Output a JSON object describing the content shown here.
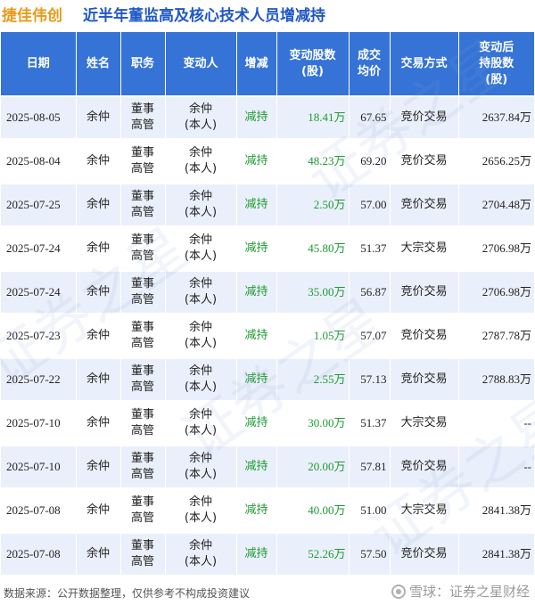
{
  "header": {
    "company": "捷佳伟创",
    "title": "近半年董监高及核心技术人员增减持"
  },
  "table": {
    "columns": [
      [
        "日期"
      ],
      [
        "姓名"
      ],
      [
        "职务"
      ],
      [
        "变动人"
      ],
      [
        "增减"
      ],
      [
        "变动股数",
        "(股)"
      ],
      [
        "成交",
        "均价"
      ],
      [
        "交易方式"
      ],
      [
        "变动后",
        "持股数",
        "(股)"
      ]
    ],
    "rows": [
      {
        "date": "2025-08-05",
        "name": "余仲",
        "position": [
          "董事",
          "高管"
        ],
        "changer": [
          "余仲",
          "(本人)"
        ],
        "direction": "减持",
        "shares": "18.41万",
        "price": "67.65",
        "method": "竞价交易",
        "after": "2637.84万"
      },
      {
        "date": "2025-08-04",
        "name": "余仲",
        "position": [
          "董事",
          "高管"
        ],
        "changer": [
          "余仲",
          "(本人)"
        ],
        "direction": "减持",
        "shares": "48.23万",
        "price": "69.20",
        "method": "竞价交易",
        "after": "2656.25万"
      },
      {
        "date": "2025-07-25",
        "name": "余仲",
        "position": [
          "董事",
          "高管"
        ],
        "changer": [
          "余仲",
          "(本人)"
        ],
        "direction": "减持",
        "shares": "2.50万",
        "price": "57.00",
        "method": "竞价交易",
        "after": "2704.48万"
      },
      {
        "date": "2025-07-24",
        "name": "余仲",
        "position": [
          "董事",
          "高管"
        ],
        "changer": [
          "余仲",
          "(本人)"
        ],
        "direction": "减持",
        "shares": "45.80万",
        "price": "51.37",
        "method": "大宗交易",
        "after": "2706.98万"
      },
      {
        "date": "2025-07-24",
        "name": "余仲",
        "position": [
          "董事",
          "高管"
        ],
        "changer": [
          "余仲",
          "(本人)"
        ],
        "direction": "减持",
        "shares": "35.00万",
        "price": "56.87",
        "method": "竞价交易",
        "after": "2706.98万"
      },
      {
        "date": "2025-07-23",
        "name": "余仲",
        "position": [
          "董事",
          "高管"
        ],
        "changer": [
          "余仲",
          "(本人)"
        ],
        "direction": "减持",
        "shares": "1.05万",
        "price": "57.07",
        "method": "竞价交易",
        "after": "2787.78万"
      },
      {
        "date": "2025-07-22",
        "name": "余仲",
        "position": [
          "董事",
          "高管"
        ],
        "changer": [
          "余仲",
          "(本人)"
        ],
        "direction": "减持",
        "shares": "2.55万",
        "price": "57.13",
        "method": "竞价交易",
        "after": "2788.83万"
      },
      {
        "date": "2025-07-10",
        "name": "余仲",
        "position": [
          "董事",
          "高管"
        ],
        "changer": [
          "余仲",
          "(本人)"
        ],
        "direction": "减持",
        "shares": "30.00万",
        "price": "51.37",
        "method": "大宗交易",
        "after": "--"
      },
      {
        "date": "2025-07-10",
        "name": "余仲",
        "position": [
          "董事",
          "高管"
        ],
        "changer": [
          "余仲",
          "(本人)"
        ],
        "direction": "减持",
        "shares": "20.00万",
        "price": "57.81",
        "method": "竞价交易",
        "after": "--"
      },
      {
        "date": "2025-07-08",
        "name": "余仲",
        "position": [
          "董事",
          "高管"
        ],
        "changer": [
          "余仲",
          "(本人)"
        ],
        "direction": "减持",
        "shares": "40.00万",
        "price": "51.00",
        "method": "大宗交易",
        "after": "2841.38万"
      },
      {
        "date": "2025-07-08",
        "name": "余仲",
        "position": [
          "董事",
          "高管"
        ],
        "changer": [
          "余仲",
          "(本人)"
        ],
        "direction": "减持",
        "shares": "52.26万",
        "price": "57.50",
        "method": "竞价交易",
        "after": "2841.38万"
      }
    ]
  },
  "footer": {
    "source": "数据来源：公开数据整理，仅供参考不构成投资建议",
    "brand": "雪球：证券之星财经",
    "brand_icon": "snowball-icon"
  },
  "watermark": {
    "text": "证券之星"
  },
  "colors": {
    "header_bg": "#3573d6",
    "row_alt_bg": "#eaf0fb",
    "green": "#1e9a2f",
    "company": "#e69a1c",
    "title": "#1f57c7"
  }
}
